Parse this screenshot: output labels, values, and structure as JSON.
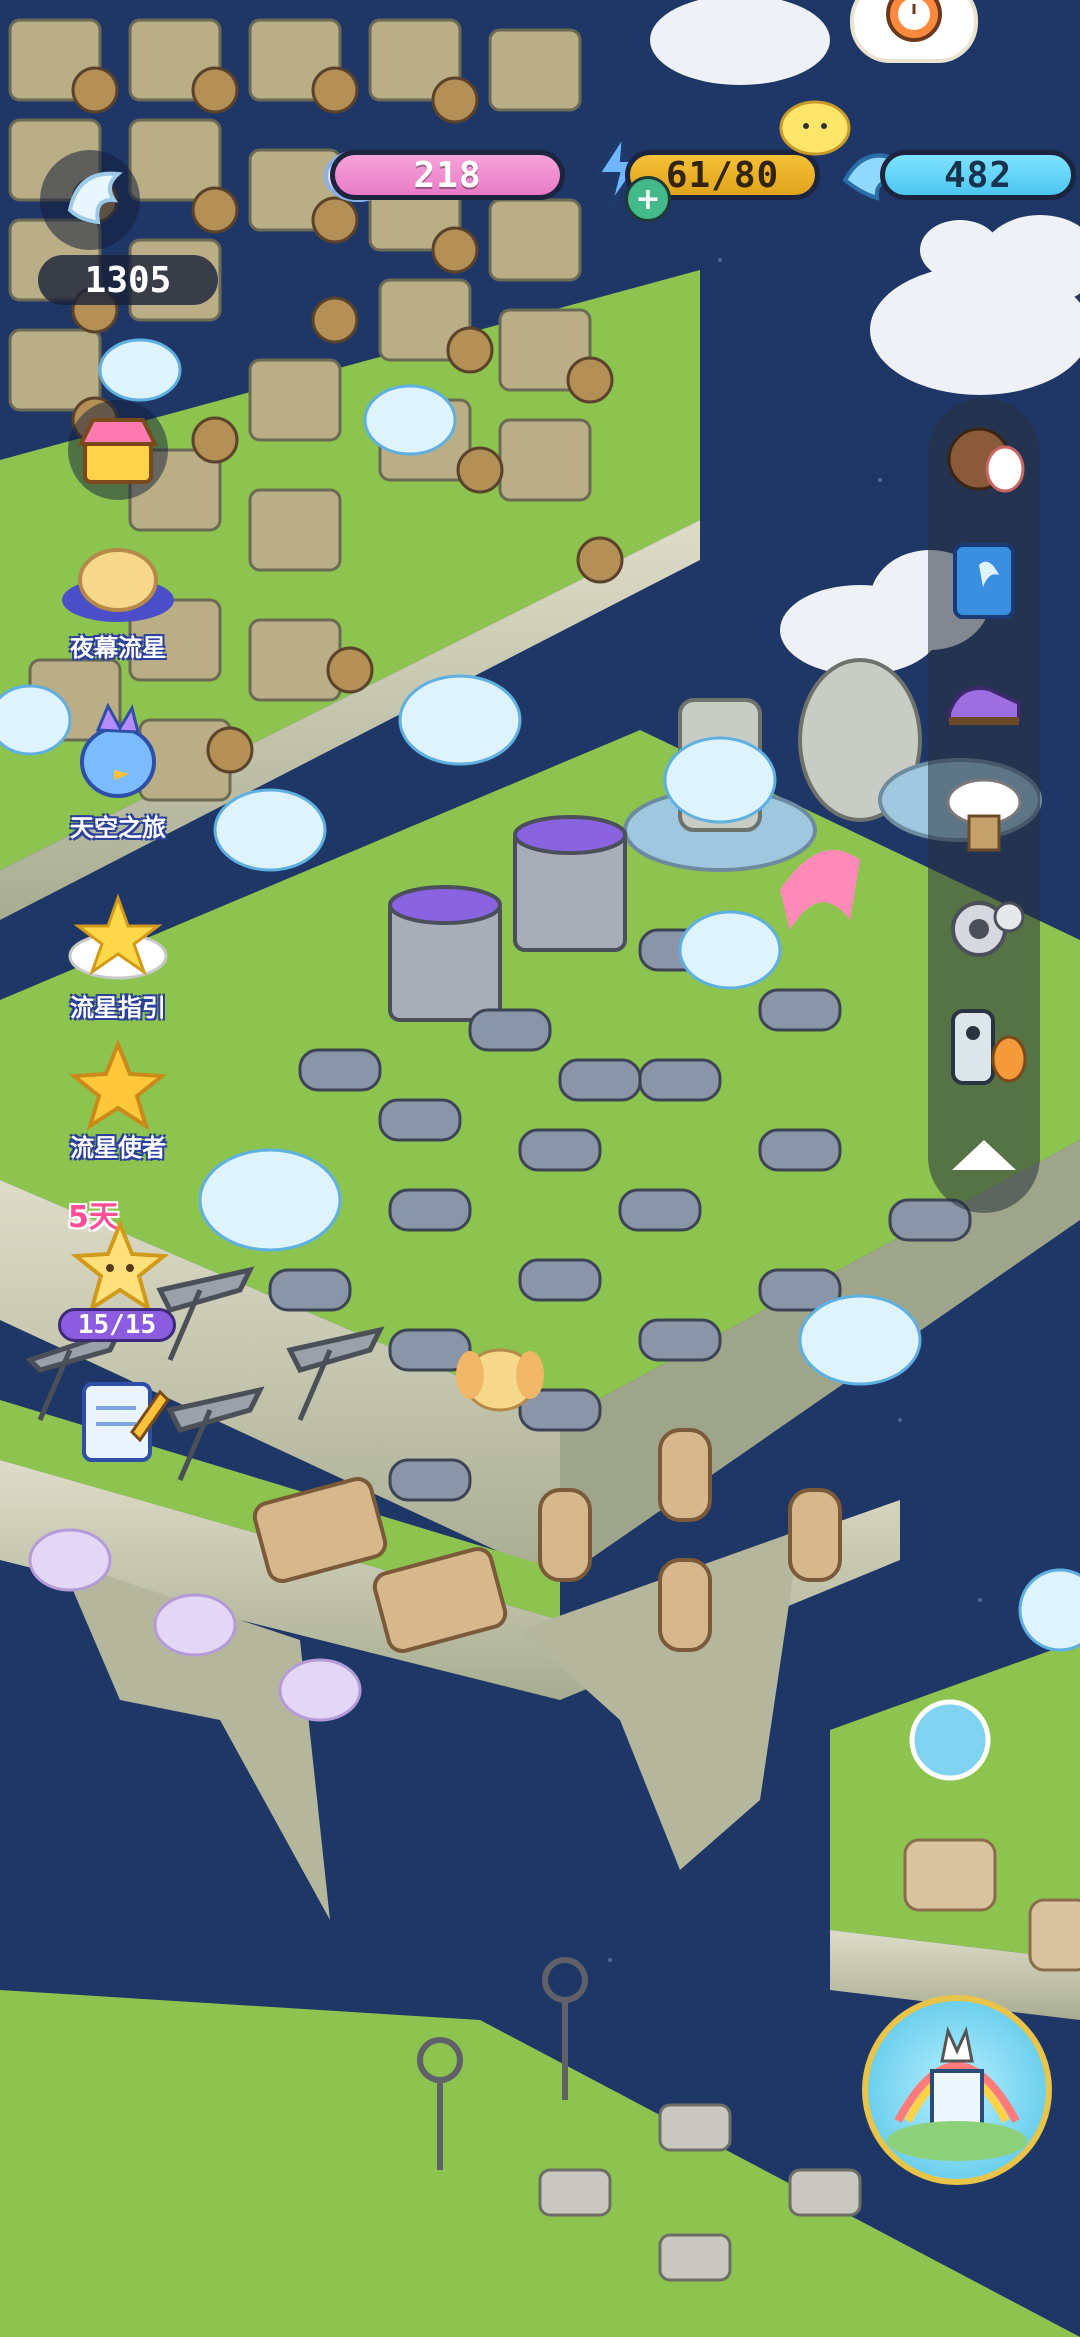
{
  "hud": {
    "cloud_currency": "218",
    "energy": "61/80",
    "gems": "482",
    "wings": "1305"
  },
  "left_menu": {
    "items": [
      {
        "label": "夜幕流星",
        "icon": "sleeping-puppy-icon"
      },
      {
        "label": "天空之旅",
        "icon": "blue-bird-icon"
      },
      {
        "label": "流星指引",
        "icon": "star-cloud-icon"
      },
      {
        "label": "流星使者",
        "icon": "gold-star-icon"
      }
    ],
    "event_days": "5天",
    "event_progress": "15/15"
  },
  "right_menu": {
    "icons": [
      "bear-rabbit-icon",
      "blue-book-icon",
      "shoe-icon",
      "cloud-gift-icon",
      "gear-icon",
      "remote-control-icon",
      "collapse-arrow-icon"
    ]
  },
  "colors": {
    "sky": "#1f3766",
    "grass": "#8cc44f",
    "accent_pink": "#e97ac8",
    "accent_gold": "#e0a31c",
    "accent_cyan": "#4cc6f0"
  }
}
